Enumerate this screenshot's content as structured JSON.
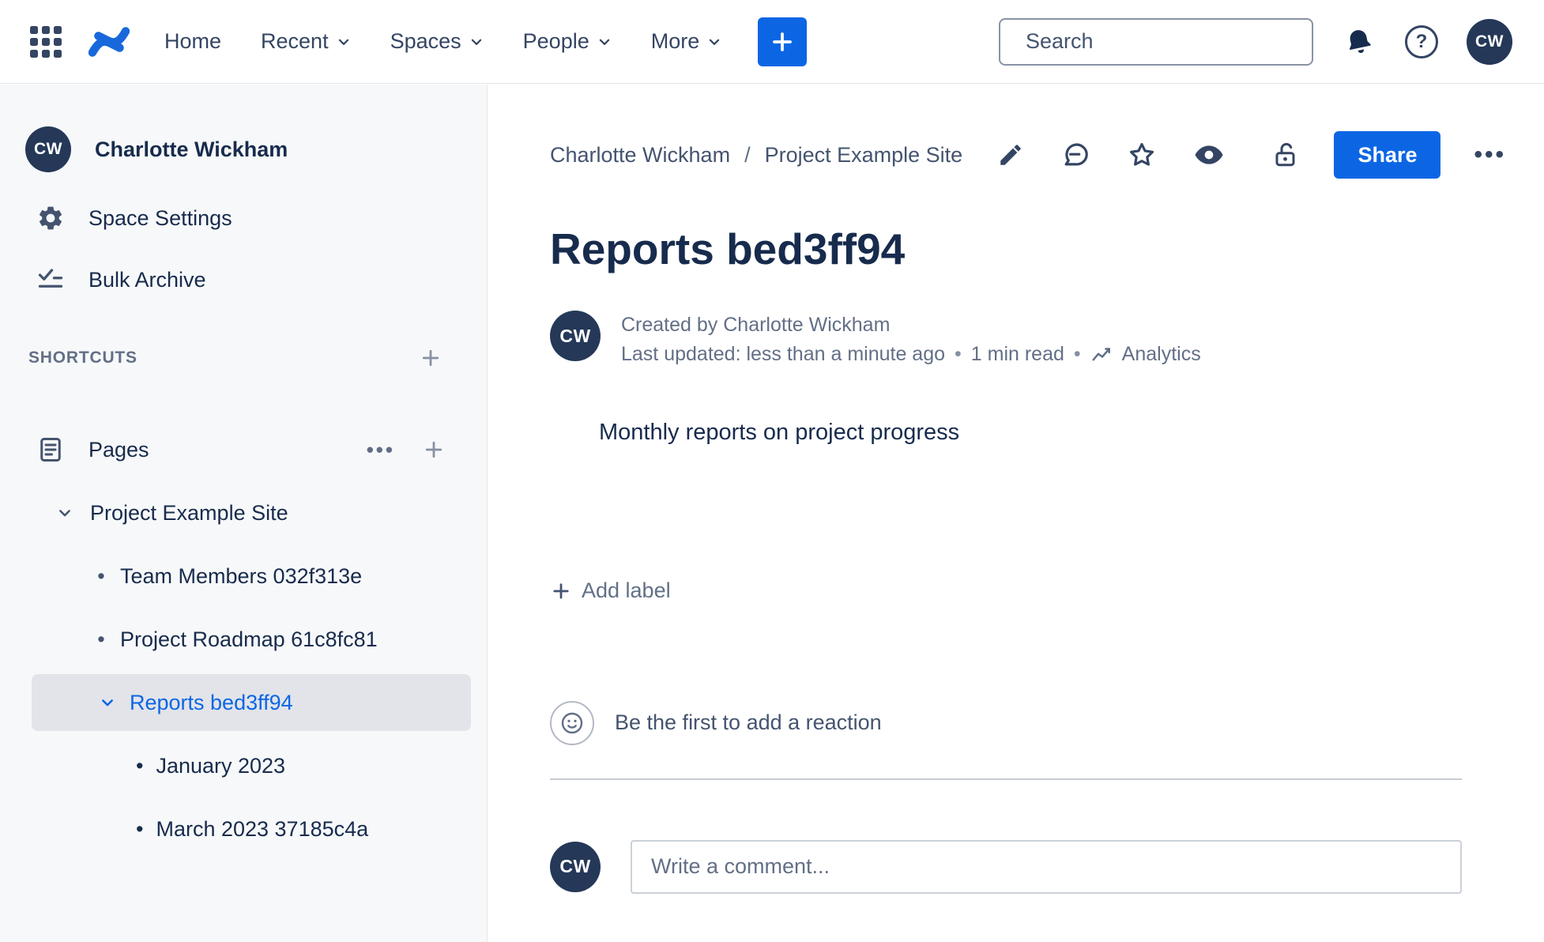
{
  "colors": {
    "accent": "#0C66E4",
    "brand_logo": "#1868DB",
    "avatar_bg": "#253858",
    "selected_text": "#0C66E4"
  },
  "topnav": {
    "items": [
      "Home",
      "Recent",
      "Spaces",
      "People",
      "More"
    ],
    "search_placeholder": "Search",
    "avatar_initials": "CW"
  },
  "sidebar": {
    "profile": {
      "initials": "CW",
      "name": "Charlotte Wickham"
    },
    "space_settings_label": "Space Settings",
    "bulk_archive_label": "Bulk Archive",
    "shortcuts_header": "SHORTCUTS",
    "pages_label": "Pages",
    "tree": {
      "root": "Project Example Site",
      "children": [
        "Team Members 032f313e",
        "Project Roadmap 61c8fc81",
        "Reports bed3ff94",
        "January 2023",
        "March 2023 37185c4a"
      ]
    }
  },
  "content": {
    "breadcrumb": [
      "Charlotte Wickham",
      "Project Example Site"
    ],
    "breadcrumb_separator": "/",
    "share_label": "Share",
    "title": "Reports bed3ff94",
    "byline": {
      "initials": "CW",
      "created": "Created by Charlotte Wickham",
      "updated": "Last updated: less than a minute ago",
      "read_time": "1 min read",
      "analytics_label": "Analytics"
    },
    "body_text": "Monthly reports on project progress",
    "add_label_text": "Add label",
    "reaction_text": "Be the first to add a reaction",
    "comment": {
      "initials": "CW",
      "placeholder": "Write a comment..."
    }
  }
}
